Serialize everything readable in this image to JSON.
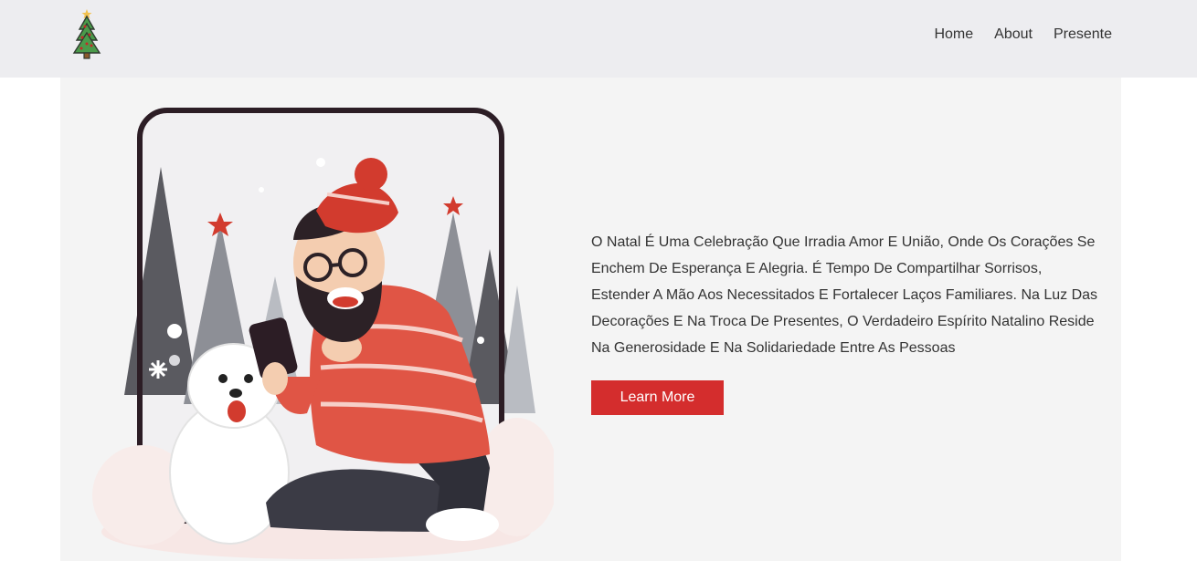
{
  "nav": {
    "logo_icon": "christmas-tree-icon",
    "links": [
      "Home",
      "About",
      "Presente"
    ]
  },
  "hero": {
    "illustration": "man-in-santa-hat-with-dog-illustration",
    "text": "O Natal É Uma Celebração Que Irradia Amor E União, Onde Os Corações Se Enchem De Esperança E Alegria. É Tempo De Compartilhar Sorrisos, Estender A Mão Aos Necessitados E Fortalecer Laços Familiares. Na Luz Das Decorações E Na Troca De Presentes, O Verdadeiro Espírito Natalino Reside Na Generosidade E Na Solidariedade Entre As Pessoas",
    "button_label": "Learn More"
  },
  "colors": {
    "navbar_bg": "#ededf0",
    "hero_bg": "#f4f4f4",
    "accent": "#d42d2d"
  }
}
